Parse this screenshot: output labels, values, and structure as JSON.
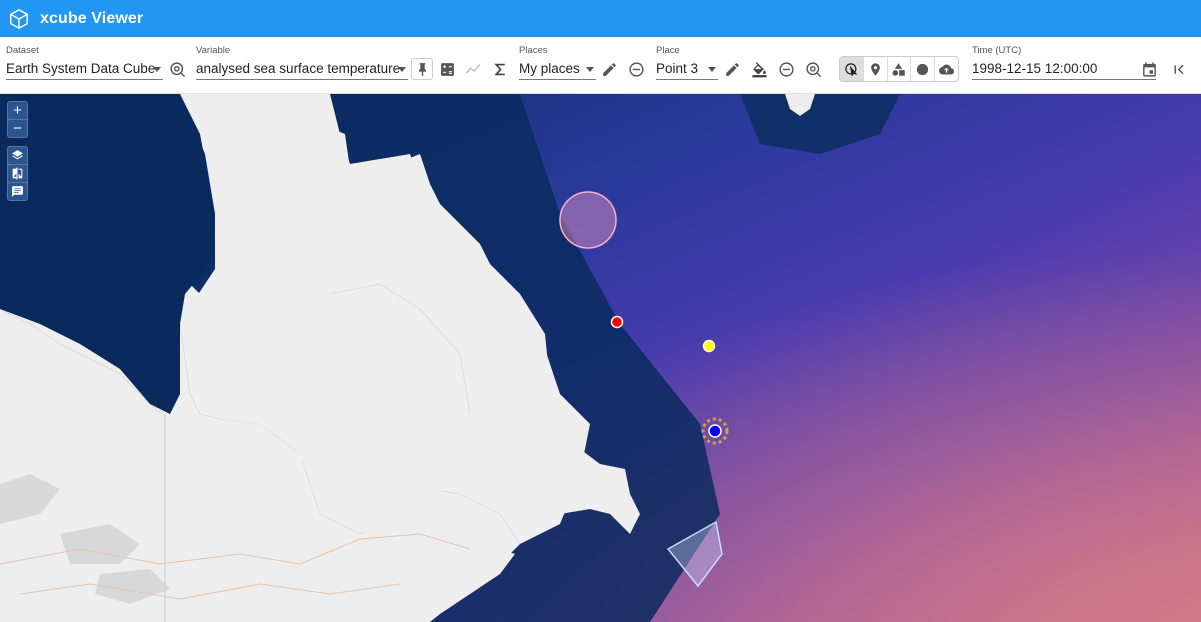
{
  "app": {
    "title": "xcube Viewer",
    "logo_icon": "cube-icon"
  },
  "toolbar": {
    "dataset": {
      "label": "Dataset",
      "value": "Earth System Data Cube"
    },
    "variable": {
      "label": "Variable",
      "value": "analysed sea surface temperature"
    },
    "places": {
      "label": "Places",
      "value": "My places"
    },
    "place": {
      "label": "Place",
      "value": "Point 3"
    },
    "time": {
      "label": "Time (UTC)",
      "value": "1998-12-15 12:00:00"
    },
    "icons": [
      "dataset-locate-icon",
      "pin-icon",
      "calculator-icon",
      "timeseries-icon",
      "sigma-icon",
      "edit-icon",
      "remove-icon",
      "edit-icon",
      "fill-color-icon",
      "remove-icon",
      "place-locate-icon",
      "select-tool-icon",
      "point-tool-icon",
      "shapes-tool-icon",
      "circle-tool-icon",
      "upload-icon",
      "calendar-icon",
      "first-step-icon"
    ]
  },
  "map": {
    "controls": {
      "zoom_in": "+",
      "zoom_out": "−"
    },
    "markers": [
      {
        "name": "red-point",
        "color": "#ff0000"
      },
      {
        "name": "yellow-point",
        "color": "#ffff00"
      },
      {
        "name": "blue-point-selected",
        "color": "#0000ff"
      }
    ],
    "colors": {
      "land": "#f0f0f0",
      "cold_sea": "#0a2a5e",
      "mid_sea": "#4a35a8",
      "warm_sea": "#c06488"
    }
  }
}
